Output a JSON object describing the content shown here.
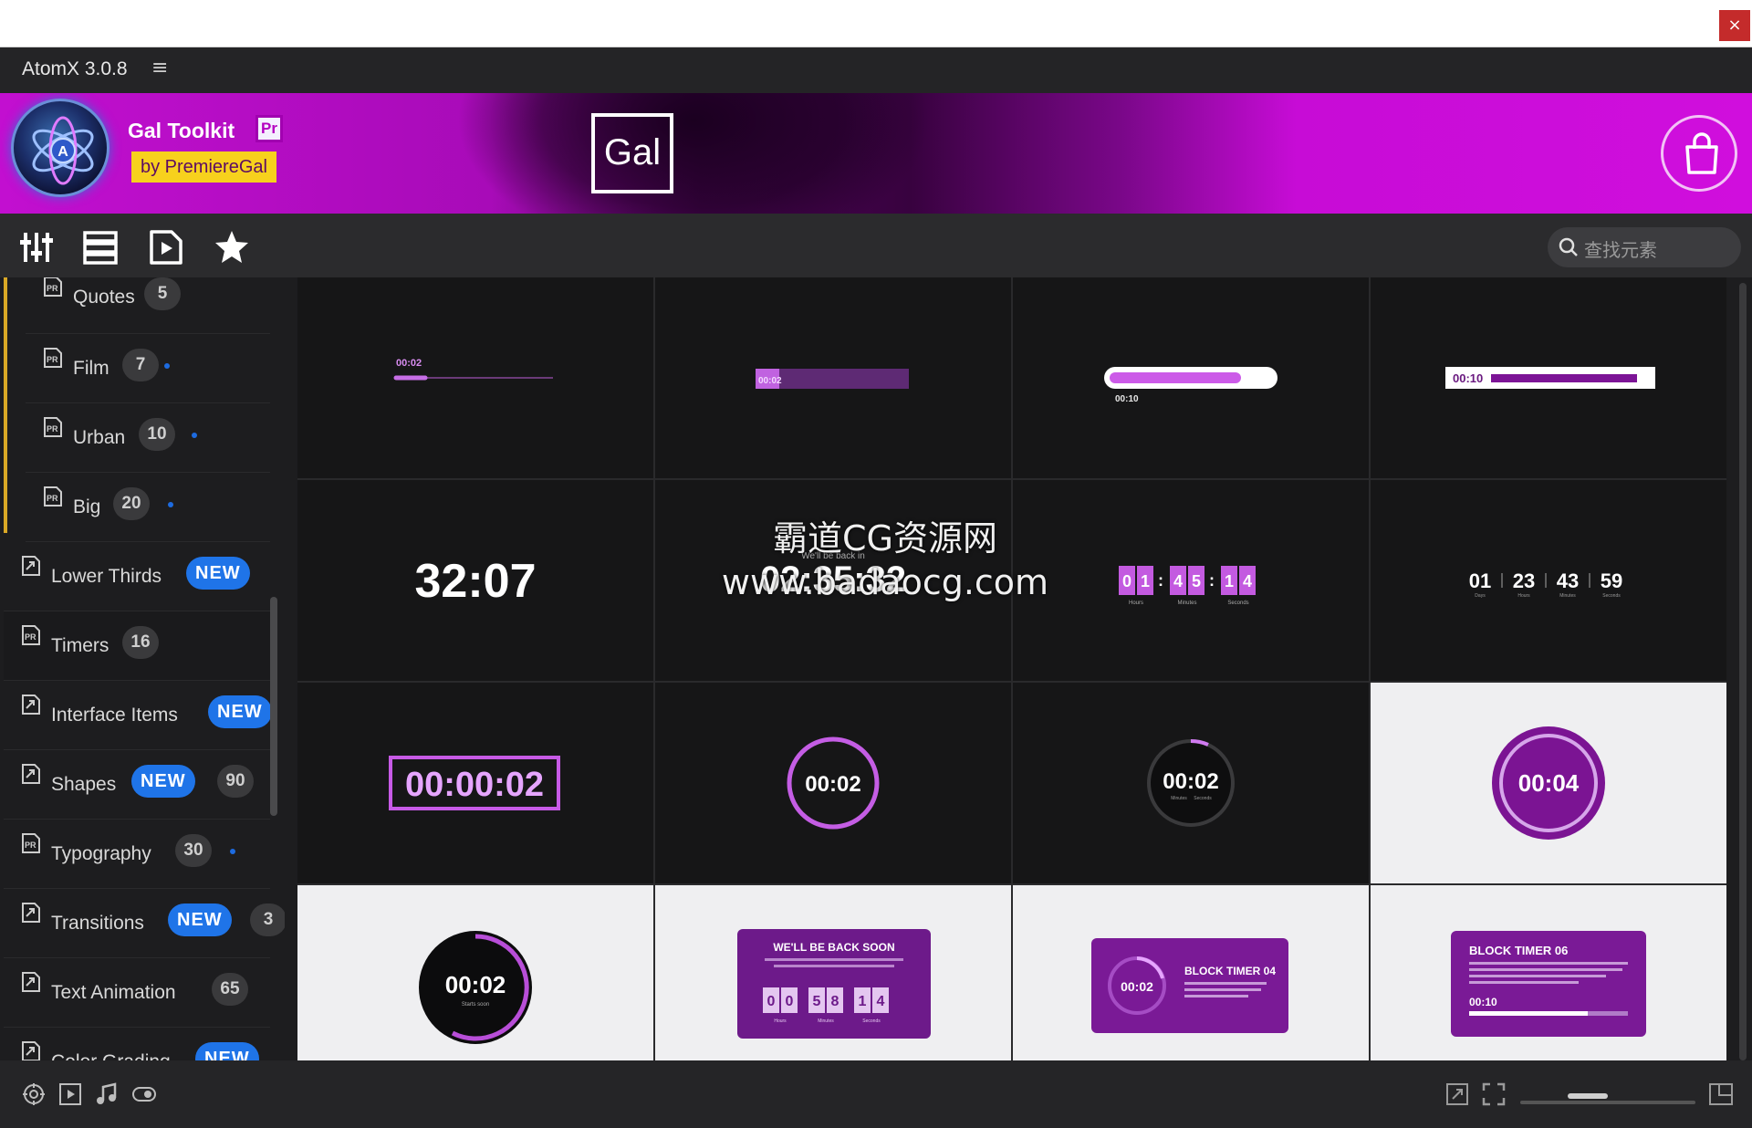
{
  "window": {
    "close_label": "×",
    "app_title": "AtomX 3.0.8",
    "menu_icon": "hamburger-menu-icon"
  },
  "banner": {
    "pack_name": "Gal Toolkit",
    "pr_badge": "Pr",
    "author": "by PremiereGal",
    "center_logo": "Gal",
    "bag_icon": "shopping-bag-icon"
  },
  "toolbar": {
    "icons": [
      "sliders-icon",
      "list-view-icon",
      "media-file-icon",
      "star-icon"
    ],
    "search_placeholder": "查找元素"
  },
  "sidebar": {
    "sub_items": [
      {
        "label": "Quotes",
        "count": "5"
      },
      {
        "label": "Film",
        "count": "7"
      },
      {
        "label": "Urban",
        "count": "10"
      },
      {
        "label": "Big",
        "count": "20"
      }
    ],
    "items": [
      {
        "label": "Lower Thirds",
        "badge": "NEW",
        "count": ""
      },
      {
        "label": "Timers",
        "badge": "",
        "count": "16"
      },
      {
        "label": "Interface Items",
        "badge": "NEW",
        "count": ""
      },
      {
        "label": "Shapes",
        "badge": "NEW",
        "count": "90"
      },
      {
        "label": "Typography",
        "badge": "",
        "count": "30"
      },
      {
        "label": "Transitions",
        "badge": "NEW",
        "count": "3"
      },
      {
        "label": "Text Animation",
        "badge": "",
        "count": "65"
      },
      {
        "label": "Color Grading",
        "badge": "NEW",
        "count": ""
      }
    ]
  },
  "grid": {
    "tiles": [
      {
        "texts": [
          "00:02"
        ]
      },
      {
        "texts": [
          "00:02"
        ]
      },
      {
        "texts": [
          "00:10"
        ]
      },
      {
        "texts": [
          "00:10"
        ]
      },
      {
        "texts": [
          "32:07"
        ]
      },
      {
        "texts": [
          "02:35:32",
          "We'll be back in"
        ]
      },
      {
        "texts": [
          "0",
          "1",
          "4",
          "5",
          "1",
          "4",
          "Hours",
          "Minutes",
          "Seconds"
        ]
      },
      {
        "texts": [
          "01",
          "23",
          "43",
          "59",
          "Days",
          "Hours",
          "Minutes",
          "Seconds"
        ]
      },
      {
        "texts": [
          "00:00:02"
        ]
      },
      {
        "texts": [
          "00:02"
        ]
      },
      {
        "texts": [
          "00:02",
          "Minutes",
          "Seconds"
        ]
      },
      {
        "texts": [
          "00:04"
        ]
      },
      {
        "texts": [
          "00:02",
          "Starts soon"
        ]
      },
      {
        "texts": [
          "WE'LL BE BACK SOON",
          "0",
          "0",
          "5",
          "8",
          "1",
          "4",
          "Hours",
          "Minutes",
          "Seconds"
        ]
      },
      {
        "texts": [
          "00:02",
          "BLOCK TIMER 04"
        ]
      },
      {
        "texts": [
          "BLOCK TIMER 06",
          "00:10"
        ]
      }
    ]
  },
  "watermark": {
    "line1": "霸道CG资源网",
    "line2": "www.badaocg.com"
  },
  "statusbar": {
    "left_icons": [
      "motion-graphics-icon",
      "video-icon",
      "music-icon",
      "toggle-icon"
    ],
    "right_icons": [
      "expand-icon",
      "fit-icon",
      "fullscreen-icon"
    ],
    "zoom_level": 0.35
  },
  "colors": {
    "accent_purple": "#c20fd0",
    "new_badge": "#1f74e8",
    "active_marker": "#d9a826",
    "close": "#c42b2b"
  }
}
